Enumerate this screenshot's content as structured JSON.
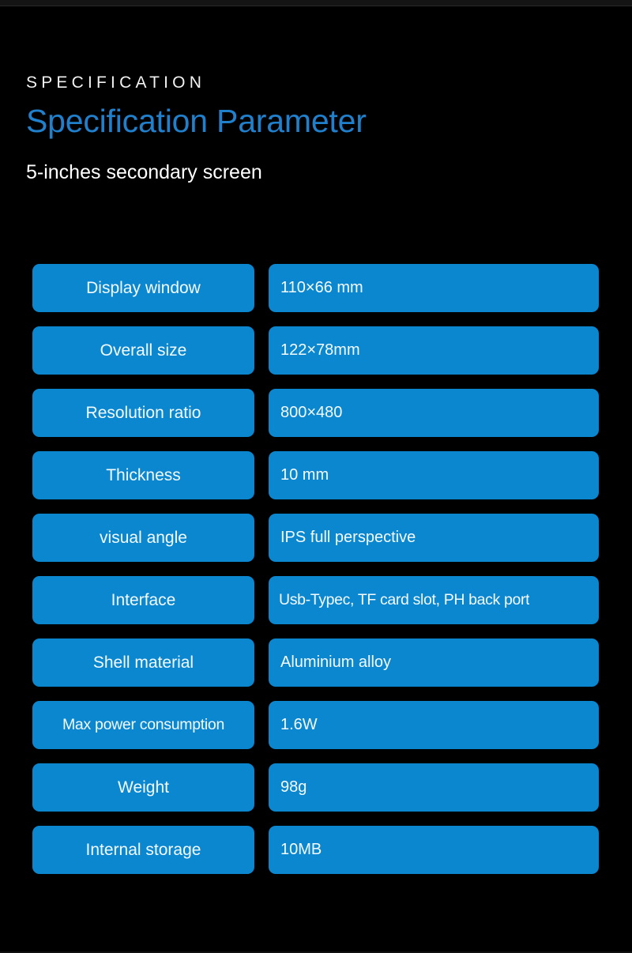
{
  "header": {
    "eyebrow": "SPECIFICATION",
    "title": "Specification Parameter",
    "subtitle": "5-inches secondary screen"
  },
  "colors": {
    "background": "#000000",
    "pill_blue": "#0b87d0",
    "title_blue": "#2180cc",
    "text_white": "#f4fbff"
  },
  "spec_table": {
    "rows": [
      {
        "label": "Display window",
        "value": "110×66 mm"
      },
      {
        "label": "Overall size",
        "value": "122×78mm"
      },
      {
        "label": "Resolution ratio",
        "value": "800×480"
      },
      {
        "label": "Thickness",
        "value": "10 mm"
      },
      {
        "label": "visual angle",
        "value": "IPS full perspective"
      },
      {
        "label": "Interface",
        "value": "Usb-Typec, TF card slot, PH back port"
      },
      {
        "label": "Shell material",
        "value": "Aluminium alloy"
      },
      {
        "label": "Max power consumption",
        "value": "1.6W"
      },
      {
        "label": "Weight",
        "value": "98g"
      },
      {
        "label": "Internal storage",
        "value": "10MB"
      }
    ]
  }
}
